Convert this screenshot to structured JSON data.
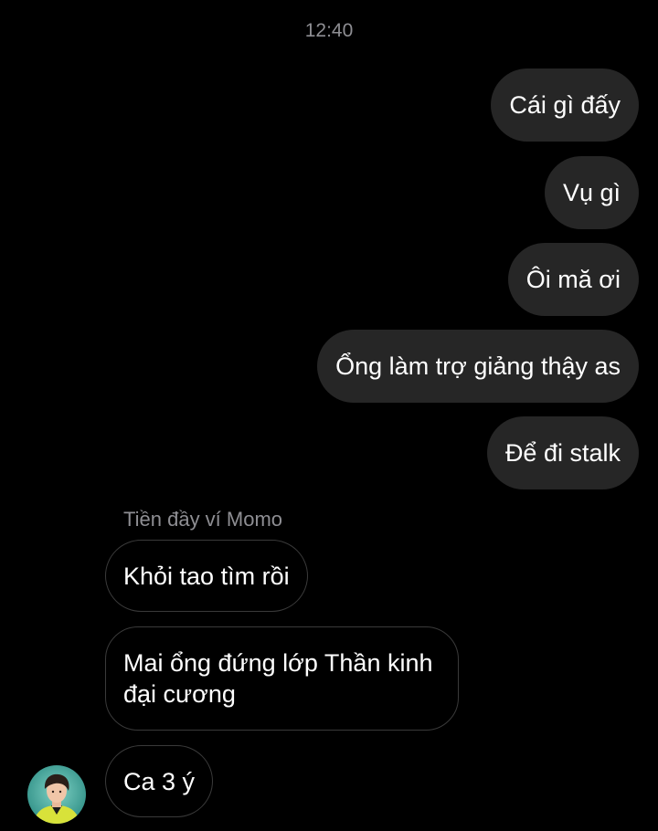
{
  "thread": {
    "timestamp": "12:40",
    "sent_messages": [
      "Cái gì đấy",
      "Vụ gì",
      "Ôi mă ơi",
      "Ổng làm trợ giảng thậy as",
      "Để đi stalk"
    ],
    "sender_name": "Tiền đầy ví Momo",
    "received_messages": [
      "Khỏi tao tìm rồi",
      "Mai ổng đứng lớp Thần kinh đại cương",
      "Ca 3 ý"
    ],
    "avatar": {
      "icon": "contact-avatar-icon"
    }
  },
  "colors": {
    "background": "#000000",
    "sent_bubble": "#262626",
    "received_border": "#3a3a3a",
    "meta_text": "#8e8e93"
  }
}
